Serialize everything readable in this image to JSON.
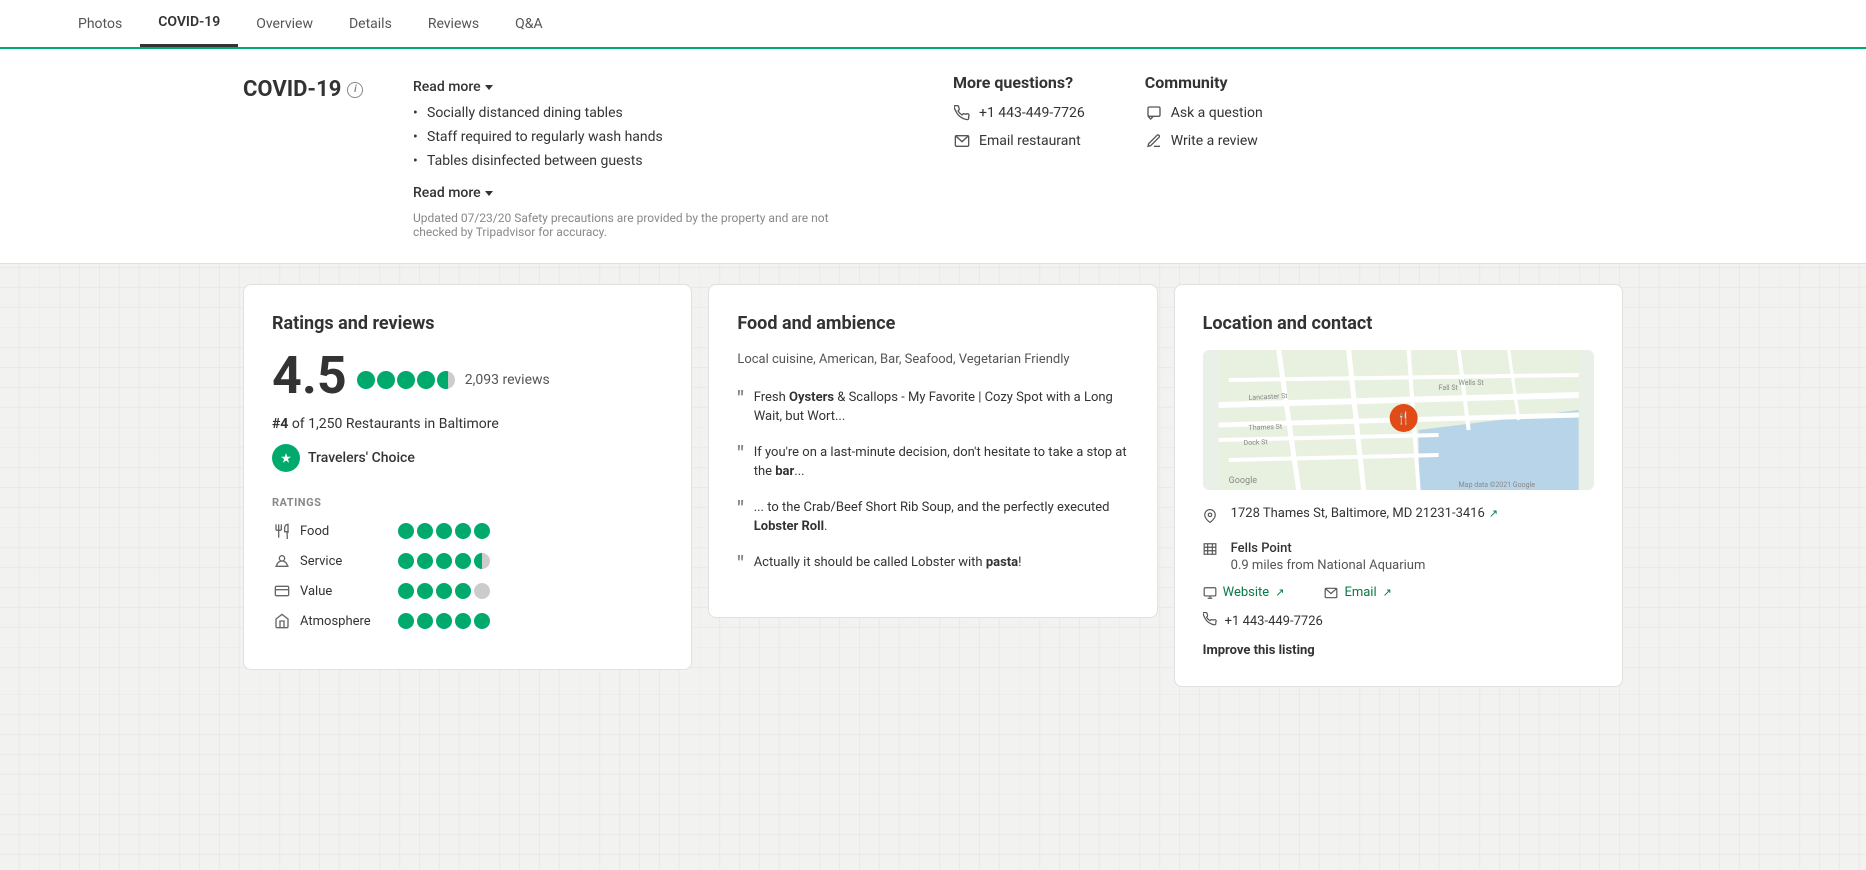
{
  "nav": {
    "items": [
      {
        "label": "Photos",
        "active": false
      },
      {
        "label": "COVID-19",
        "active": true
      },
      {
        "label": "Overview",
        "active": false
      },
      {
        "label": "Details",
        "active": false
      },
      {
        "label": "Reviews",
        "active": false
      },
      {
        "label": "Q&A",
        "active": false
      }
    ]
  },
  "covid": {
    "title": "COVID-19",
    "read_more_top": "Read more",
    "bullets": [
      "Socially distanced dining tables",
      "Staff required to regularly wash hands",
      "Tables disinfected between guests"
    ],
    "read_more_bottom": "Read more",
    "note": "Updated 07/23/20 Safety precautions are provided by the property and are not checked by Tripadvisor for accuracy.",
    "more_questions_title": "More questions?",
    "phone": "+1 443-449-7726",
    "email_label": "Email restaurant",
    "community_title": "Community",
    "ask_question": "Ask a question",
    "write_review": "Write a review"
  },
  "ratings": {
    "section_title": "Ratings and reviews",
    "score": "4.5",
    "review_count": "2,093 reviews",
    "rank": "#4",
    "rank_suffix": "of 1,250 Restaurants in Baltimore",
    "travelers_choice": "Travelers' Choice",
    "ratings_label": "RATINGS",
    "sub_ratings": [
      {
        "label": "Food",
        "dots": 5,
        "icon": "fork"
      },
      {
        "label": "Service",
        "dots": 4.5,
        "icon": "service"
      },
      {
        "label": "Value",
        "dots": 4,
        "icon": "value"
      },
      {
        "label": "Atmosphere",
        "dots": 5,
        "icon": "atmosphere"
      }
    ]
  },
  "food": {
    "section_title": "Food and ambience",
    "cuisine": "Local cuisine, American, Bar, Seafood, Vegetarian Friendly",
    "quotes": [
      {
        "text": "Fresh Oysters & Scallops - My Favorite | Cozy Spot with a Long Wait, but Wort...",
        "bold_word": "Oysters"
      },
      {
        "text": "If you're on a last-minute decision, don't hesitate to take a stop at the bar...",
        "bold_word": "bar"
      },
      {
        "text": "... to the Crab/Beef Short Rib Soup, and the perfectly executed Lobster Roll.",
        "bold_word": "Lobster Roll"
      },
      {
        "text": "Actually it should be called Lobster with pasta!",
        "bold_word": "pasta"
      }
    ]
  },
  "location": {
    "section_title": "Location and contact",
    "address": "1728 Thames St, Baltimore, MD 21231-3416",
    "neighborhood": "Fells Point",
    "distance": "0.9 miles from National Aquarium",
    "website_label": "Website",
    "email_label": "Email",
    "phone": "+1 443-449-7726",
    "improve_label": "Improve this listing"
  }
}
